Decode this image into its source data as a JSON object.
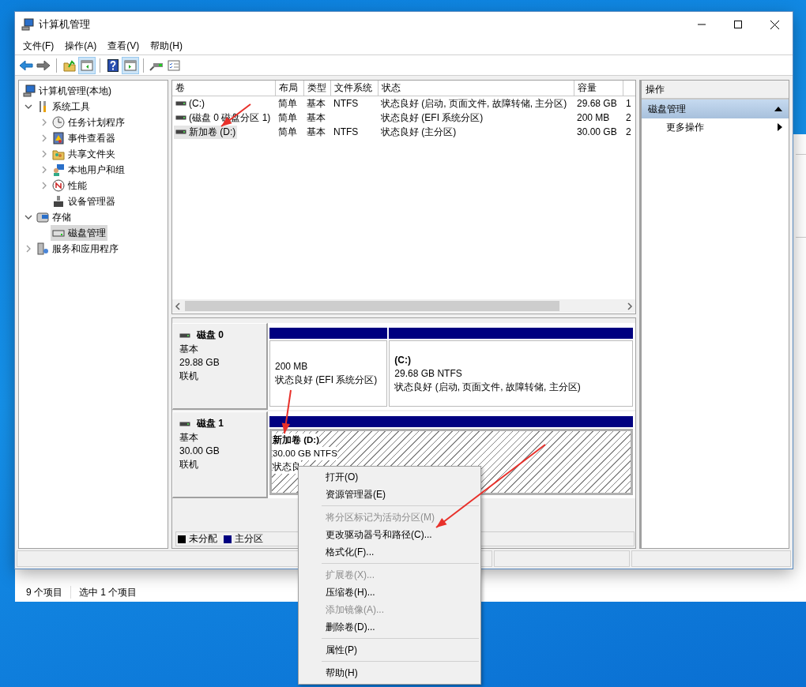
{
  "window": {
    "title": "计算机管理"
  },
  "menu_bar": [
    {
      "label": "文件(F)"
    },
    {
      "label": "操作(A)"
    },
    {
      "label": "查看(V)"
    },
    {
      "label": "帮助(H)"
    }
  ],
  "toolbar": [
    [
      {
        "kind": "back",
        "pressed": false
      },
      {
        "kind": "forward",
        "pressed": false
      }
    ],
    [
      {
        "kind": "up",
        "pressed": false
      },
      {
        "kind": "tree",
        "pressed": true
      }
    ],
    [
      {
        "kind": "help",
        "pressed": false
      },
      {
        "kind": "pane",
        "pressed": true
      }
    ],
    [
      {
        "kind": "connect",
        "pressed": false
      },
      {
        "kind": "properties",
        "pressed": false
      }
    ]
  ],
  "tree": [
    {
      "label": "计算机管理(本地)",
      "kind": "computer",
      "selected": false,
      "children": [
        {
          "label": "系统工具",
          "kind": "tools",
          "expanded": true,
          "selected": false,
          "children": [
            {
              "label": "任务计划程序",
              "kind": "clock",
              "expanded": false,
              "selected": false
            },
            {
              "label": "事件查看器",
              "kind": "log",
              "expanded": false,
              "selected": false
            },
            {
              "label": "共享文件夹",
              "kind": "share",
              "expanded": false,
              "selected": false
            },
            {
              "label": "本地用户和组",
              "kind": "users",
              "expanded": false,
              "selected": false
            },
            {
              "label": "性能",
              "kind": "perf",
              "expanded": false,
              "selected": false
            },
            {
              "label": "设备管理器",
              "kind": "device",
              "selected": false
            }
          ]
        },
        {
          "label": "存储",
          "kind": "storage",
          "expanded": true,
          "selected": false,
          "children": [
            {
              "label": "磁盘管理",
              "kind": "disk",
              "selected": true
            }
          ]
        },
        {
          "label": "服务和应用程序",
          "kind": "services",
          "expanded": false,
          "selected": false
        }
      ]
    }
  ],
  "volume_list": {
    "columns": [
      "卷",
      "布局",
      "类型",
      "文件系统",
      "状态",
      "容量"
    ],
    "rows": [
      {
        "volume": "(C:)",
        "layout": "简单",
        "type": "基本",
        "file_system": "NTFS",
        "status": "状态良好 (启动, 页面文件, 故障转储, 主分区)",
        "capacity": "29.68 GB",
        "column_7": "1",
        "selected": false
      },
      {
        "volume": "(磁盘 0 磁盘分区 1)",
        "layout": "简单",
        "type": "基本",
        "status": "状态良好 (EFI 系统分区)",
        "capacity": "200 MB",
        "column_7": "2",
        "selected": false
      },
      {
        "volume": "新加卷 (D:)",
        "layout": "简单",
        "type": "基本",
        "file_system": "NTFS",
        "status": "状态良好 (主分区)",
        "capacity": "30.00 GB",
        "column_7": "2",
        "selected": true
      }
    ]
  },
  "disks": [
    {
      "name": "磁盘 0",
      "type": "基本",
      "size": "29.88 GB",
      "state": "联机",
      "partitions": [
        {
          "size": "200 MB",
          "status": "状态良好 (EFI 系统分区)",
          "selected": false
        },
        {
          "title": "(C:)",
          "size": "29.68 GB NTFS",
          "status": "状态良好 (启动, 页面文件, 故障转储, 主分区)",
          "selected": false
        }
      ]
    },
    {
      "name": "磁盘 1",
      "type": "基本",
      "size": "30.00 GB",
      "state": "联机",
      "partitions": [
        {
          "title": "新加卷  (D:)",
          "size": "30.00 GB NTFS",
          "status": "状态良",
          "selected": true
        }
      ]
    }
  ],
  "legend": [
    {
      "label": "未分配",
      "color": "#000000"
    },
    {
      "label": "主分区",
      "color": "#000080"
    }
  ],
  "actions": {
    "title": "操作",
    "sections": [
      {
        "label": "磁盘管理",
        "expanded": true,
        "items": [
          {
            "label": "更多操作"
          }
        ]
      }
    ]
  },
  "context_menu": {
    "items": [
      {
        "kind": "item",
        "label": "打开(O)",
        "disabled": false
      },
      {
        "kind": "item",
        "label": "资源管理器(E)",
        "disabled": false
      },
      {
        "kind": "separator"
      },
      {
        "kind": "item",
        "label": "将分区标记为活动分区(M)",
        "disabled": true
      },
      {
        "kind": "item",
        "label": "更改驱动器号和路径(C)...",
        "disabled": false
      },
      {
        "kind": "item",
        "label": "格式化(F)...",
        "disabled": false
      },
      {
        "kind": "separator"
      },
      {
        "kind": "item",
        "label": "扩展卷(X)...",
        "disabled": true
      },
      {
        "kind": "item",
        "label": "压缩卷(H)...",
        "disabled": false
      },
      {
        "kind": "item",
        "label": "添加镜像(A)...",
        "disabled": true
      },
      {
        "kind": "item",
        "label": "删除卷(D)...",
        "disabled": false
      },
      {
        "kind": "separator"
      },
      {
        "kind": "item",
        "label": "属性(P)",
        "disabled": false
      },
      {
        "kind": "separator"
      },
      {
        "kind": "item",
        "label": "帮助(H)",
        "disabled": false
      }
    ]
  },
  "background_window": {
    "status_bar": [
      "9 个项目",
      "选中 1 个项目"
    ]
  }
}
